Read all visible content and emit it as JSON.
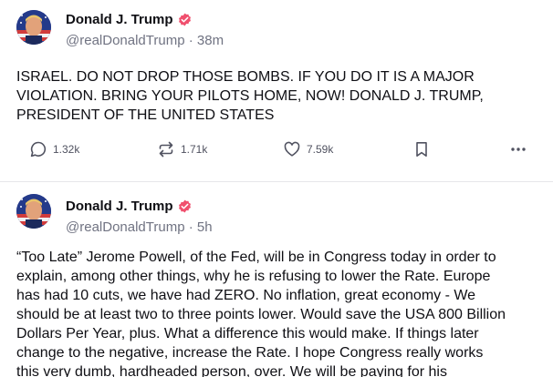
{
  "posts": [
    {
      "author": {
        "name": "Donald J. Trump",
        "handle": "@realDonaldTrump",
        "time": "38m"
      },
      "text": "ISRAEL. DO NOT DROP THOSE BOMBS. IF YOU DO IT IS A MAJOR\nVIOLATION. BRING YOUR PILOTS HOME, NOW!  DONALD J. TRUMP,\nPRESIDENT OF THE UNITED STATES",
      "stats": {
        "replies": "1.32k",
        "retruths": "1.71k",
        "likes": "7.59k"
      }
    },
    {
      "author": {
        "name": "Donald J. Trump",
        "handle": "@realDonaldTrump",
        "time": "5h"
      },
      "text": "“Too Late” Jerome Powell, of the Fed, will be in Congress today in order to\nexplain, among other things, why he is refusing to lower the Rate. Europe\nhas had 10 cuts, we have had ZERO. No inflation, great economy - We\nshould be at least two to three points lower. Would save the USA 800 Billion\nDollars Per Year, plus. What a difference this would make. If things later\nchange to the negative, increase the Rate. I hope Congress really works\nthis very dumb, hardheaded person, over. We will be paying for his"
    }
  ],
  "separator": " · ",
  "colors": {
    "verified": "#f0506e",
    "muted": "#707382",
    "divider": "#e6e6ea"
  },
  "icons": [
    "reply-icon",
    "retruth-icon",
    "like-icon",
    "bookmark-icon",
    "more-icon",
    "verified-icon"
  ]
}
